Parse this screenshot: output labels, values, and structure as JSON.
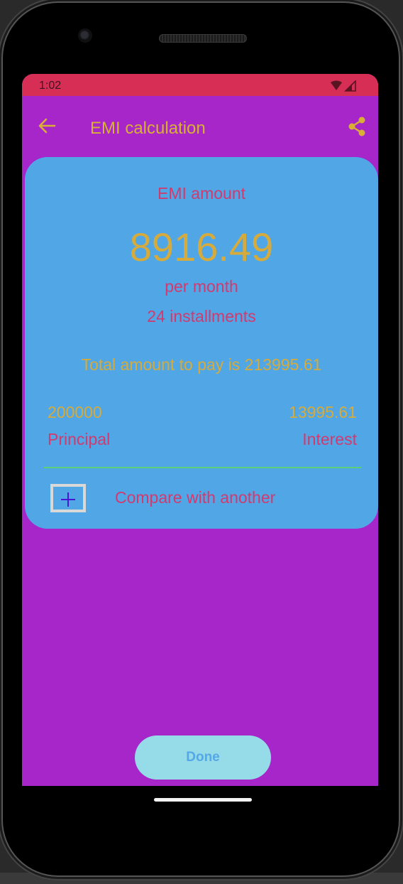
{
  "status_bar": {
    "time": "1:02",
    "icons": [
      "wifi-icon",
      "cell-signal-icon"
    ],
    "color": "#d62e55"
  },
  "app_bar": {
    "back_icon": "arrow-left-icon",
    "title": "EMI calculation",
    "share_icon": "share-icon"
  },
  "card": {
    "emi_label": "EMI amount",
    "emi_value": "8916.49",
    "per_month": "per month",
    "installments": "24 installments",
    "total_line": "Total amount to pay is 213995.61",
    "principal_value": "200000",
    "principal_label": "Principal",
    "interest_value": "13995.61",
    "interest_label": "Interest",
    "compare_icon": "plus-icon",
    "compare_label": "Compare with another"
  },
  "footer": {
    "done_label": "Done"
  },
  "colors": {
    "screen_background": "#a626c9",
    "card_background": "#51a7e6",
    "accent_gold": "#d6ab3b",
    "accent_pink": "#d13a6e",
    "divider_green": "#5fd07a",
    "done_button": "#96dce8"
  }
}
